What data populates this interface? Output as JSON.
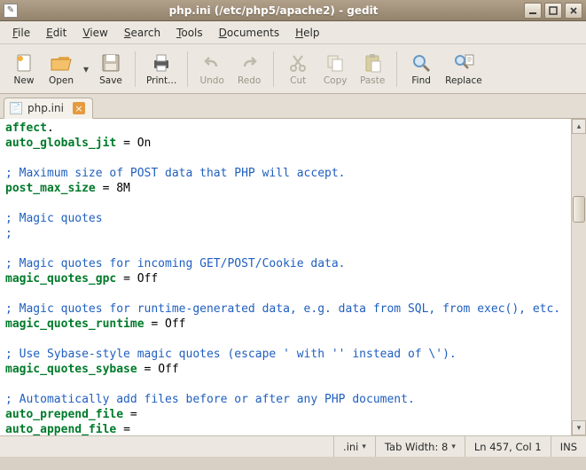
{
  "window": {
    "title": "php.ini (/etc/php5/apache2) - gedit"
  },
  "menu": {
    "file": "File",
    "edit": "Edit",
    "view": "View",
    "search": "Search",
    "tools": "Tools",
    "documents": "Documents",
    "help": "Help"
  },
  "toolbar": {
    "new": "New",
    "open": "Open",
    "save": "Save",
    "print": "Print...",
    "undo": "Undo",
    "redo": "Redo",
    "cut": "Cut",
    "copy": "Copy",
    "paste": "Paste",
    "find": "Find",
    "replace": "Replace"
  },
  "tabs": {
    "items": [
      {
        "label": "php.ini"
      }
    ]
  },
  "editor": {
    "lines": [
      {
        "t": "key-partial",
        "key": "affect",
        "text": "."
      },
      {
        "t": "kv",
        "key": "auto_globals_jit",
        "val": "On"
      },
      {
        "t": "blank"
      },
      {
        "t": "comment",
        "text": "; Maximum size of POST data that PHP will accept."
      },
      {
        "t": "kv",
        "key": "post_max_size",
        "val": "8M"
      },
      {
        "t": "blank"
      },
      {
        "t": "comment",
        "text": "; Magic quotes"
      },
      {
        "t": "comment",
        "text": ";"
      },
      {
        "t": "blank"
      },
      {
        "t": "comment",
        "text": "; Magic quotes for incoming GET/POST/Cookie data."
      },
      {
        "t": "kv",
        "key": "magic_quotes_gpc",
        "val": "Off"
      },
      {
        "t": "blank"
      },
      {
        "t": "comment",
        "text": "; Magic quotes for runtime-generated data, e.g. data from SQL, from exec(), etc."
      },
      {
        "t": "kv",
        "key": "magic_quotes_runtime",
        "val": "Off"
      },
      {
        "t": "blank"
      },
      {
        "t": "comment",
        "text": "; Use Sybase-style magic quotes (escape ' with '' instead of \\')."
      },
      {
        "t": "kv",
        "key": "magic_quotes_sybase",
        "val": "Off"
      },
      {
        "t": "blank"
      },
      {
        "t": "comment",
        "text": "; Automatically add files before or after any PHP document."
      },
      {
        "t": "kv",
        "key": "auto_prepend_file",
        "val": ""
      },
      {
        "t": "kv",
        "key": "auto_append_file",
        "val": ""
      }
    ]
  },
  "status": {
    "syntax": ".ini",
    "tabwidth": "Tab Width: 8",
    "position": "Ln 457, Col 1",
    "insmode": "INS"
  }
}
